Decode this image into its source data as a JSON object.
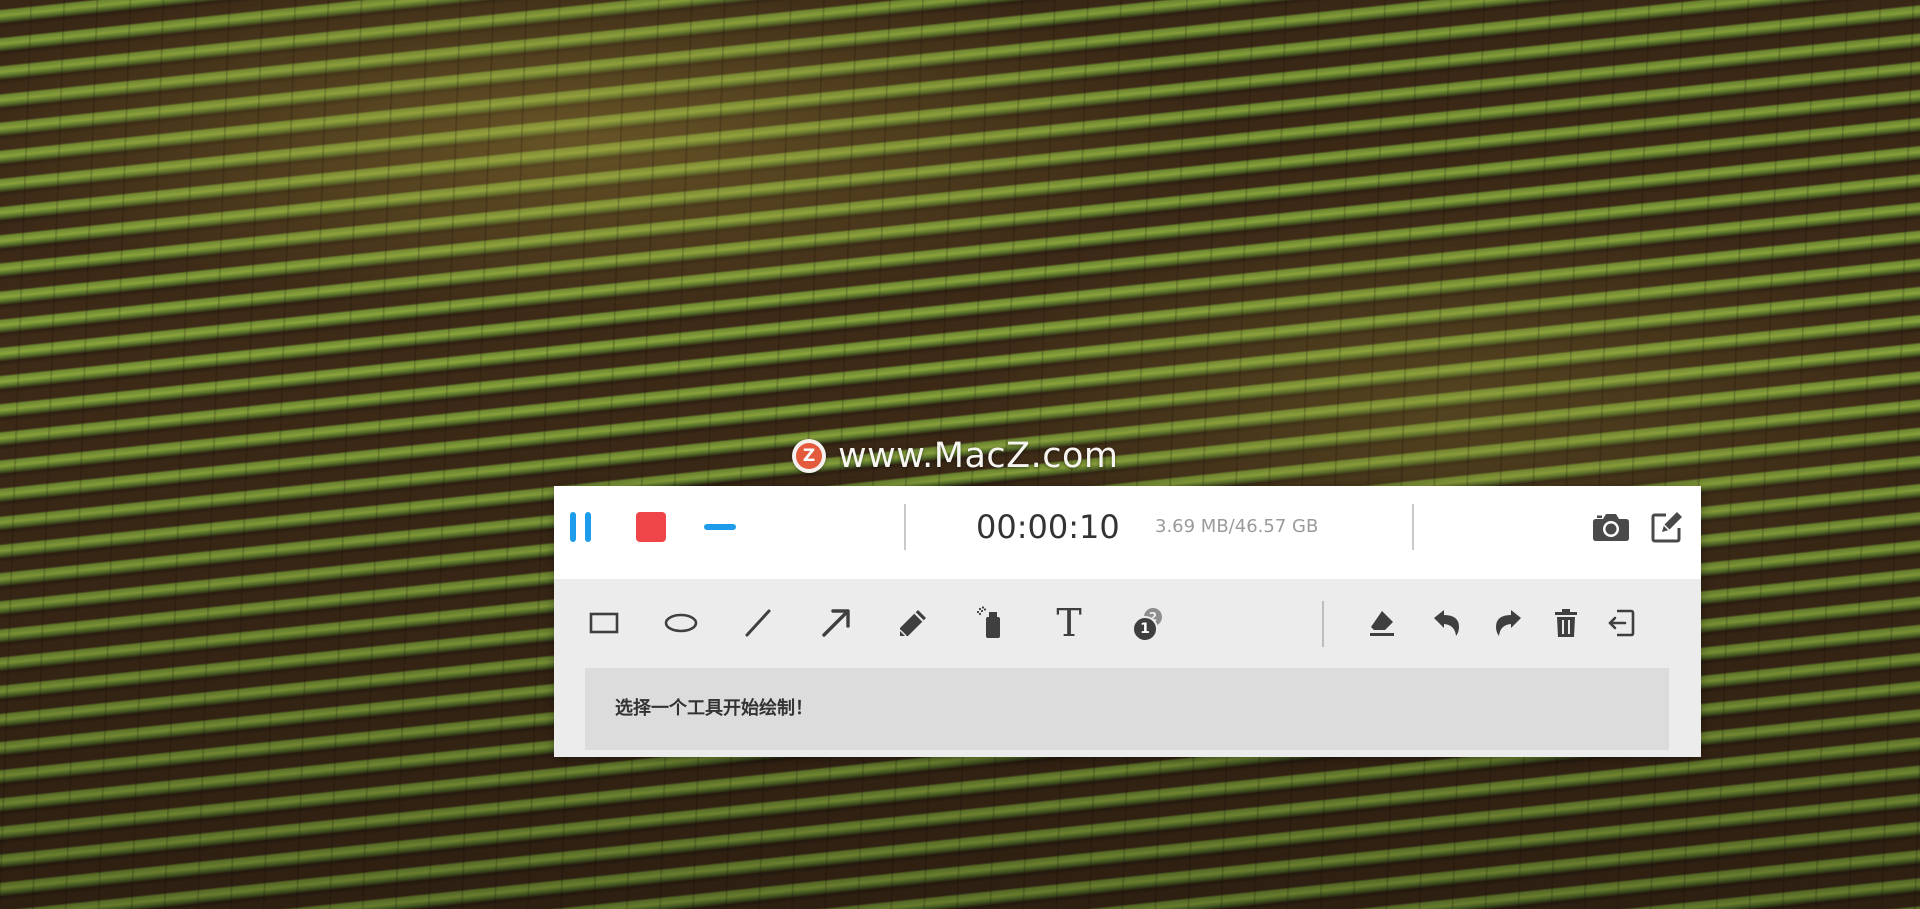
{
  "watermark": {
    "logo_letter": "Z",
    "text": "www.MacZ.com"
  },
  "recorder": {
    "timer": "00:00:10",
    "storage": "3.69 MB/46.57 GB",
    "controls": {
      "pause_icon": "pause-icon",
      "stop_icon": "stop-icon",
      "minimize_icon": "minimize-icon",
      "camera_icon": "camera-icon",
      "edit_icon": "edit-icon"
    },
    "tools": [
      {
        "id": "rectangle",
        "icon": "rectangle-icon"
      },
      {
        "id": "ellipse",
        "icon": "ellipse-icon"
      },
      {
        "id": "line",
        "icon": "line-icon"
      },
      {
        "id": "arrow",
        "icon": "arrow-icon"
      },
      {
        "id": "pencil",
        "icon": "pencil-icon"
      },
      {
        "id": "spray",
        "icon": "spray-icon"
      },
      {
        "id": "text",
        "icon": "text-icon",
        "glyph": "T"
      },
      {
        "id": "number",
        "icon": "number-badge-icon",
        "glyph": "1",
        "sub_glyph": "2"
      },
      {
        "id": "eraser",
        "icon": "eraser-icon"
      },
      {
        "id": "undo",
        "icon": "undo-icon"
      },
      {
        "id": "redo",
        "icon": "redo-icon"
      },
      {
        "id": "delete",
        "icon": "trash-icon"
      },
      {
        "id": "exit",
        "icon": "exit-icon"
      }
    ],
    "hint": "选择一个工具开始绘制！"
  },
  "colors": {
    "accent_blue": "#1e9cec",
    "stop_red": "#ef4548",
    "toolbar_gray": "#ececec",
    "hint_gray": "#dcdcdc"
  }
}
